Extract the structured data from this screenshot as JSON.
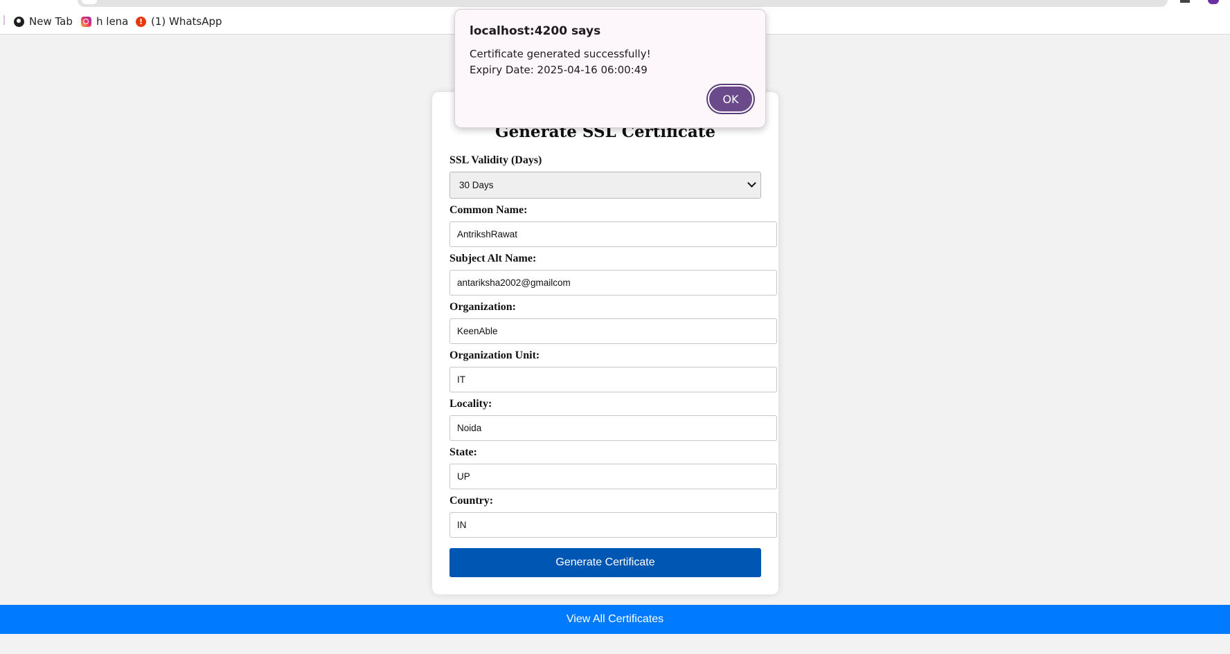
{
  "bookmarks": [
    {
      "label": "New Tab",
      "icon": "globe-icon"
    },
    {
      "label": "h lena",
      "icon": "instagram-icon"
    },
    {
      "label": "(1) WhatsApp",
      "icon": "whatsapp-icon"
    }
  ],
  "dialog": {
    "title": "localhost:4200 says",
    "message_line1": "Certificate generated successfully!",
    "message_line2": "Expiry Date: 2025-04-16 06:00:49",
    "ok_label": "OK"
  },
  "form": {
    "title": "Generate SSL Certificate",
    "validity": {
      "label": "SSL Validity (Days)",
      "value": "30 Days"
    },
    "common_name": {
      "label": "Common Name:",
      "value": "AntrikshRawat"
    },
    "subject_alt_name": {
      "label": "Subject Alt Name:",
      "value": "antariksha2002@gmailcom"
    },
    "organization": {
      "label": "Organization:",
      "value": "KeenAble"
    },
    "organization_unit": {
      "label": "Organization Unit:",
      "value": "IT"
    },
    "locality": {
      "label": "Locality:",
      "value": "Noida"
    },
    "state": {
      "label": "State:",
      "value": "UP"
    },
    "country": {
      "label": "Country:",
      "value": "IN"
    },
    "submit_label": "Generate Certificate"
  },
  "view_all_label": "View All Certificates",
  "colors": {
    "primary_button": "#0056b3",
    "view_all_bar": "#007bff",
    "dialog_ok": "#6a4a8a",
    "page_background": "#f2f2f2"
  }
}
